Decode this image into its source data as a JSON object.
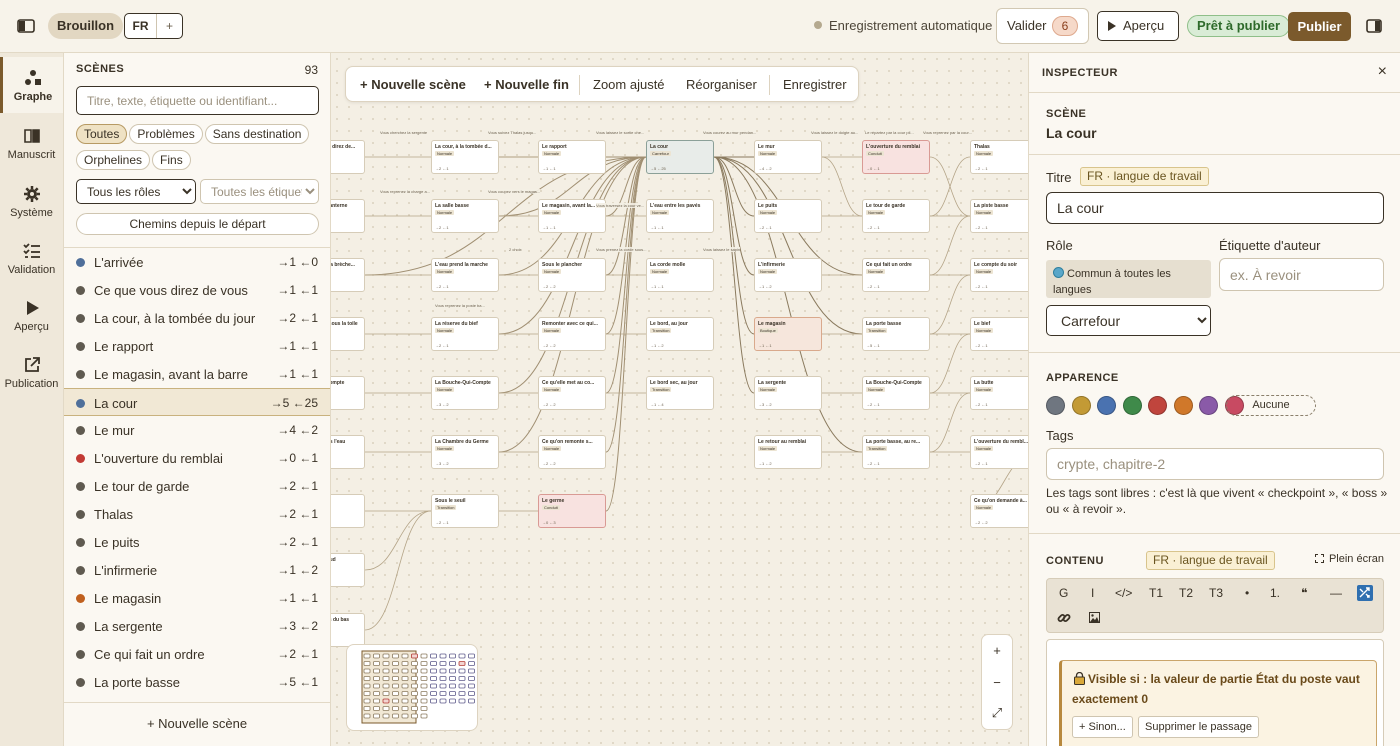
{
  "topbar": {
    "status": "Brouillon",
    "lang": "FR",
    "lang_add": "+",
    "autosave": "Enregistrement automatique",
    "validate": "Valider",
    "validate_count": "6",
    "preview": "Aperçu",
    "ready": "Prêt à publier",
    "publish": "Publier"
  },
  "rail": [
    {
      "label": "Graphe",
      "icon": "graph-icon"
    },
    {
      "label": "Manuscrit",
      "icon": "book-icon"
    },
    {
      "label": "Système",
      "icon": "gear-icon"
    },
    {
      "label": "Validation",
      "icon": "checklist-icon"
    },
    {
      "label": "Aperçu",
      "icon": "play-icon"
    },
    {
      "label": "Publication",
      "icon": "external-link-icon"
    }
  ],
  "scenes": {
    "title": "SCÈNES",
    "count": "93",
    "search_placeholder": "Titre, texte, étiquette ou identifiant...",
    "filters": [
      "Toutes",
      "Problèmes",
      "Sans destination",
      "Orphelines",
      "Fins"
    ],
    "roles_select": "Tous les rôles",
    "tags_select": "Toutes les étiquettes",
    "paths_button": "Chemins depuis le départ",
    "new_scene": "+ Nouvelle scène",
    "items": [
      {
        "name": "L'arrivée",
        "links": "→1 ←0",
        "color": "#4f6f9a"
      },
      {
        "name": "Ce que vous direz de vous",
        "links": "→1 ←1",
        "color": "#5f5a50"
      },
      {
        "name": "La cour, à la tombée du jour",
        "links": "→2 ←1",
        "color": "#5f5a50"
      },
      {
        "name": "Le rapport",
        "links": "→1 ←1",
        "color": "#5f5a50"
      },
      {
        "name": "Le magasin, avant la barre",
        "links": "→1 ←1",
        "color": "#5f5a50"
      },
      {
        "name": "La cour",
        "links": "→5 ←25",
        "color": "#4f6f9a"
      },
      {
        "name": "Le mur",
        "links": "→4 ←2",
        "color": "#5f5a50"
      },
      {
        "name": "L'ouverture du remblai",
        "links": "→0 ←1",
        "color": "#c23a34"
      },
      {
        "name": "Le tour de garde",
        "links": "→2 ←1",
        "color": "#5f5a50"
      },
      {
        "name": "Thalas",
        "links": "→2 ←1",
        "color": "#5f5a50"
      },
      {
        "name": "Le puits",
        "links": "→2 ←1",
        "color": "#5f5a50"
      },
      {
        "name": "L'infirmerie",
        "links": "→1 ←2",
        "color": "#5f5a50"
      },
      {
        "name": "Le magasin",
        "links": "→1 ←1",
        "color": "#c0601e"
      },
      {
        "name": "La sergente",
        "links": "→3 ←2",
        "color": "#5f5a50"
      },
      {
        "name": "Ce qui fait un ordre",
        "links": "→2 ←1",
        "color": "#5f5a50"
      },
      {
        "name": "La porte basse",
        "links": "→5 ←1",
        "color": "#5f5a50"
      }
    ]
  },
  "graph": {
    "toolbar": {
      "new_scene": "+ Nouvelle scène",
      "new_end": "+ Nouvelle fin",
      "zoom_fit": "Zoom ajusté",
      "reorganize": "Réorganiser",
      "save": "Enregistrer"
    },
    "zoom_in": "+",
    "zoom_out": "−",
    "zoom_fit_icon": "⤢",
    "nodes": [
      {
        "title": "Ce que vous direz de...",
        "badge": "Normale",
        "counts": "→1 ←1",
        "style": ""
      },
      {
        "title": "La cour, à la tombée d...",
        "badge": "Normale",
        "counts": "→2 ←1",
        "style": ""
      },
      {
        "title": "Le rapport",
        "badge": "Normale",
        "counts": "→1 ←1",
        "style": ""
      },
      {
        "title": "La cour",
        "badge": "Carrefour",
        "counts": "→5 ←25",
        "style": "sel"
      },
      {
        "title": "Le mur",
        "badge": "Normale",
        "counts": "→4 ←2",
        "style": ""
      },
      {
        "title": "L'ouverture du remblai",
        "badge": "Conduit",
        "counts": "→0 ←1",
        "style": "end"
      },
      {
        "title": "Thalas",
        "badge": "Normale",
        "counts": "→2 ←1",
        "style": ""
      },
      {
        "title": "Le droit de lanterne",
        "badge": "Normale",
        "counts": "→1 ←2",
        "style": ""
      },
      {
        "title": "La salle basse",
        "badge": "Normale",
        "counts": "→2 ←1",
        "style": ""
      },
      {
        "title": "Le magasin, avant la...",
        "badge": "Normale",
        "counts": "→1 ←1",
        "style": ""
      },
      {
        "title": "L'eau entre les pavés",
        "badge": "Normale",
        "counts": "→1 ←1",
        "style": ""
      },
      {
        "title": "Le puits",
        "badge": "Normale",
        "counts": "→2 ←1",
        "style": ""
      },
      {
        "title": "Le tour de garde",
        "badge": "Normale",
        "counts": "→2 ←1",
        "style": ""
      },
      {
        "title": "La piste basse",
        "badge": "Normale",
        "counts": "→2 ←1",
        "style": ""
      },
      {
        "title": "Le compte, la brèche...",
        "badge": "Normale",
        "counts": "→1 ←1",
        "style": ""
      },
      {
        "title": "L'eau prend la marche",
        "badge": "Normale",
        "counts": "→2 ←1",
        "style": ""
      },
      {
        "title": "Sous le plancher",
        "badge": "Normale",
        "counts": "→2 ←2",
        "style": ""
      },
      {
        "title": "La corde molle",
        "badge": "Normale",
        "counts": "→1 ←1",
        "style": ""
      },
      {
        "title": "L'infirmerie",
        "badge": "Normale",
        "counts": "→1 ←2",
        "style": ""
      },
      {
        "title": "Ce qui fait un ordre",
        "badge": "Normale",
        "counts": "→2 ←1",
        "style": ""
      },
      {
        "title": "Le compte du soir",
        "badge": "Normale",
        "counts": "→2 ←1",
        "style": ""
      },
      {
        "title": "Le compte, sous la toile",
        "badge": "Normale",
        "counts": "→1 ←1",
        "style": ""
      },
      {
        "title": "La réserve du bief",
        "badge": "Normale",
        "counts": "→2 ←1",
        "style": ""
      },
      {
        "title": "Remonter avec ce qui...",
        "badge": "Normale",
        "counts": "→2 ←2",
        "style": ""
      },
      {
        "title": "Le bord, au jour",
        "badge": "Transition",
        "counts": "→1 ←2",
        "style": ""
      },
      {
        "title": "Le magasin",
        "badge": "Boutique",
        "counts": "→1 ←1",
        "style": "shop"
      },
      {
        "title": "La porte basse",
        "badge": "Transition",
        "counts": "→5 ←1",
        "style": ""
      },
      {
        "title": "Le bief",
        "badge": "Normale",
        "counts": "→2 ←1",
        "style": ""
      },
      {
        "title": "Le dernier compte",
        "badge": "Normale",
        "counts": "→1 ←1",
        "style": ""
      },
      {
        "title": "La Bouche-Qui-Compte",
        "badge": "Normale",
        "counts": "→3 ←2",
        "style": ""
      },
      {
        "title": "Ce qu'elle met au co...",
        "badge": "Normale",
        "counts": "→2 ←2",
        "style": ""
      },
      {
        "title": "Le bord sec, au jour",
        "badge": "Transition",
        "counts": "→1 ←4",
        "style": ""
      },
      {
        "title": "La sergente",
        "badge": "Normale",
        "counts": "→3 ←2",
        "style": ""
      },
      {
        "title": "La Bouche-Qui-Compte",
        "badge": "Normale",
        "counts": "→2 ←1",
        "style": ""
      },
      {
        "title": "La butte",
        "badge": "Normale",
        "counts": "→2 ←1",
        "style": ""
      },
      {
        "title": "Le seuil sous l'eau",
        "badge": "Normale",
        "counts": "→1 ←2",
        "style": ""
      },
      {
        "title": "La Chambre du Germe",
        "badge": "Normale",
        "counts": "→3 ←2",
        "style": ""
      },
      {
        "title": "Ce qu'on remonte s...",
        "badge": "Normale",
        "counts": "→2 ←2",
        "style": ""
      },
      {
        "title": "Le retour au remblai",
        "badge": "Normale",
        "counts": "→1 ←2",
        "style": ""
      },
      {
        "title": "La porte basse, au re...",
        "badge": "Transition",
        "counts": "→2 ←1",
        "style": ""
      },
      {
        "title": "L'ouverture du rembl...",
        "badge": "Normale",
        "counts": "→2 ←1",
        "style": ""
      },
      {
        "title": "La ronde",
        "badge": "Normale",
        "counts": "→1 ←2",
        "style": ""
      },
      {
        "title": "Sous le seuil",
        "badge": "Transition",
        "counts": "→2 ←1",
        "style": ""
      },
      {
        "title": "Le germe",
        "badge": "Conduit",
        "counts": "→0 ←3",
        "style": "end"
      },
      {
        "title": "Ce qu'on demande à...",
        "badge": "Normale",
        "counts": "→2 ←2",
        "style": ""
      },
      {
        "title": "Le seuil chaud",
        "badge": "Normale",
        "counts": "→1 ←1",
        "style": ""
      },
      {
        "title": "Les marches du bas",
        "badge": "Normale",
        "counts": "→1 ←1",
        "style": ""
      }
    ],
    "edge_labels": [
      "Vous cherchez la sergente",
      "Vous suivez Thalas jusqu...",
      "Vous laissez le sortie che...",
      "Vous courez au mur pendan...",
      "Vous laissez le doigte au...",
      "Le répartez par la cour pil...",
      "Vous reprenez par la cour...",
      "Vous reprenez la charge a...",
      "Vous coupez vers le magas...",
      "Vous traversez la cour ve...",
      "Vous laissez le sapin",
      "2 choix",
      "Vous prenez la corde sous...",
      "Vous reprenez la poste ba..."
    ]
  },
  "inspector": {
    "title": "INSPECTEUR",
    "close": "×",
    "section_label": "SCÈNE",
    "scene_name": "La cour",
    "title_label": "Titre",
    "lang_badge": "FR · langue de travail",
    "title_value": "La cour",
    "role_label": "Rôle",
    "author_tag_label": "Étiquette d'auteur",
    "common_text": "Commun à toutes les langues",
    "author_tag_placeholder": "ex. À revoir",
    "role_value": "Carrefour",
    "appearance_label": "APPARENCE",
    "swatches": [
      "#6f7680",
      "#c39a35",
      "#4a72b0",
      "#3f8a4a",
      "#c0453d",
      "#d0782a",
      "#8a5aa8",
      "#c84a62"
    ],
    "none_button": "Aucune",
    "tags_label": "Tags",
    "tags_placeholder": "crypte, chapitre-2",
    "tags_help": "Les tags sont libres : c'est là que vivent « checkpoint », « boss » ou « à revoir ».",
    "content_label": "CONTENU",
    "content_lang_badge": "FR · langue de travail",
    "fullscreen": "Plein écran",
    "format_buttons": [
      "G",
      "I",
      "</>",
      "T1",
      "T2",
      "T3",
      "•",
      "1.",
      "❝",
      "—"
    ],
    "condition_text": "Visible si : la valeur de partie État du poste vaut exactement 0",
    "else_button": "+ Sinon...",
    "delete_passage": "Supprimer le passage"
  }
}
